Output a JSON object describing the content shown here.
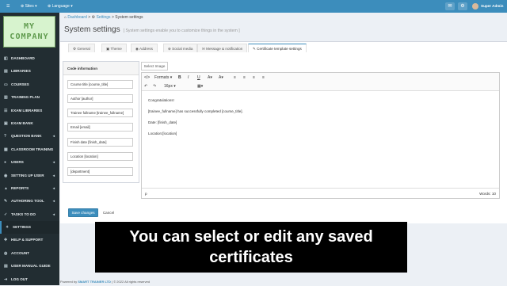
{
  "topbar": {
    "menu_icon": "hamburger-icon",
    "sites_label": "Sites",
    "language_label": "Language",
    "user_label": "Super Admin"
  },
  "brand": {
    "logo_text": "MY COMPANY"
  },
  "sidebar": {
    "items": [
      {
        "label": "DASHBOARD",
        "icon": "dashboard-icon",
        "has_children": false
      },
      {
        "label": "LIBRARIES",
        "icon": "book-icon",
        "has_children": false
      },
      {
        "label": "COURSES",
        "icon": "folder-icon",
        "has_children": false
      },
      {
        "label": "TRAINING PLAN",
        "icon": "plan-icon",
        "has_children": false
      },
      {
        "label": "EXAM LIBRARIES",
        "icon": "list-icon",
        "has_children": false
      },
      {
        "label": "EXAM BANK",
        "icon": "bank-icon",
        "has_children": false
      },
      {
        "label": "QUESTION BANK",
        "icon": "question-icon",
        "has_children": true
      },
      {
        "label": "CLASSROOM TRAINING",
        "icon": "classroom-icon",
        "has_children": false
      },
      {
        "label": "USERS",
        "icon": "users-icon",
        "has_children": true
      },
      {
        "label": "SETTING UP USER",
        "icon": "user-cog-icon",
        "has_children": true
      },
      {
        "label": "REPORTS",
        "icon": "chart-icon",
        "has_children": true
      },
      {
        "label": "AUTHORING TOOL",
        "icon": "pen-icon",
        "has_children": true
      },
      {
        "label": "TASKS TO DO",
        "icon": "tasks-icon",
        "has_children": true
      },
      {
        "label": "SETTINGS",
        "icon": "wrench-icon",
        "has_children": false
      },
      {
        "label": "HELP & SUPPORT",
        "icon": "help-icon",
        "has_children": false
      },
      {
        "label": "ACCOUNT",
        "icon": "account-icon",
        "has_children": false
      },
      {
        "label": "USER MANUAL GUIDE",
        "icon": "manual-icon",
        "has_children": false
      },
      {
        "label": "LOG OUT",
        "icon": "logout-icon",
        "has_children": false
      }
    ],
    "active_index": 13
  },
  "breadcrumb": {
    "items": [
      "Dashboard",
      "Settings",
      "System settings"
    ]
  },
  "page": {
    "title": "System settings",
    "subtitle": "[ System settings enable you to customize things in the system ]"
  },
  "tabs": [
    {
      "label": "General",
      "icon": "gear-icon"
    },
    {
      "label": "Theme",
      "icon": "theme-icon"
    },
    {
      "label": "Address",
      "icon": "pin-icon"
    },
    {
      "label": "Social media",
      "icon": "share-icon"
    },
    {
      "label": "Message & notification",
      "icon": "envelope-icon"
    },
    {
      "label": "Certificate template settings",
      "icon": "certificate-icon"
    }
  ],
  "active_tab": 5,
  "code_info": {
    "heading": "Code information",
    "codes": [
      "Course title [course_title]",
      "Author [author]",
      "Trainee fullname [trainee_fullname]",
      "Email [email]",
      "Finish date [finish_date]",
      "Location [location]",
      "[department]"
    ]
  },
  "select_image_label": "Select Image",
  "editor": {
    "format_label": "Formats",
    "font_size": "16px",
    "lines": [
      "Congratulations!",
      "[trainee_fullname] has successfully completed [course_title].",
      "Date: [finish_date]",
      "Location:[location]"
    ],
    "status_path": "p",
    "word_count": "Words: 10"
  },
  "buttons": {
    "save": "Save changes",
    "cancel": "Cancel"
  },
  "footer": {
    "prefix": "Powered by",
    "brand": "SMART TRAINER LTD",
    "suffix": "| © 2022 All rights reserved"
  },
  "caption": {
    "line1": "You can select or edit any saved",
    "line2": "certificates"
  },
  "colors": {
    "primary": "#3c8dbc",
    "sidebar": "#222d32",
    "caption_bg": "#000000"
  }
}
